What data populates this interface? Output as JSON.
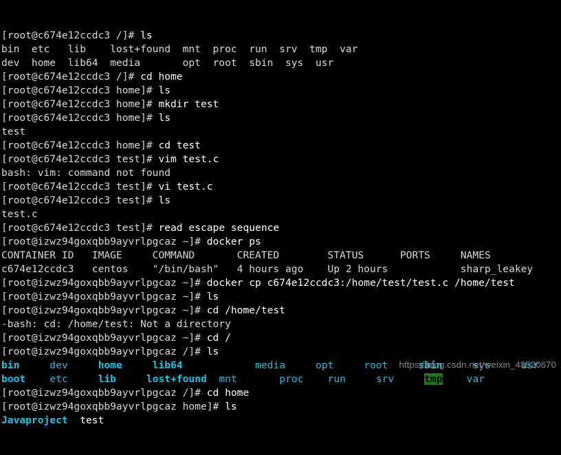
{
  "terminal": {
    "background_color": "#000000",
    "foreground_color": "#d8d8d8",
    "dir_color": "#29b8db",
    "dir_bold_color": "#29d8f0",
    "sticky_dir_bg_color": "#1c7a14",
    "sticky_dir_fg_color": "#000000",
    "prompt_container": "[root@c674e12ccdc3 /]# ",
    "prompt_container_home": "[root@c674e12ccdc3 home]# ",
    "prompt_container_test": "[root@c674e12ccdc3 test]# ",
    "prompt_host_tilde": "[root@izwz94goxqbb9ayvrlpgcaz ~]# ",
    "prompt_host_root": "[root@izwz94goxqbb9ayvrlpgcaz /]# ",
    "prompt_host_home": "[root@izwz94goxqbb9ayvrlpgcaz home]# ",
    "lines": [
      {
        "id": "l01",
        "type": "prompt",
        "prompt": "[root@c674e12ccdc3 /]# ",
        "command": "ls"
      },
      {
        "id": "l02",
        "type": "plain",
        "text": "bin  etc   lib    lost+found  mnt  proc  run  srv  tmp  var"
      },
      {
        "id": "l03",
        "type": "plain",
        "text": "dev  home  lib64  media       opt  root  sbin  sys  usr"
      },
      {
        "id": "l04",
        "type": "prompt",
        "prompt": "[root@c674e12ccdc3 /]# ",
        "command": "cd home"
      },
      {
        "id": "l05",
        "type": "prompt",
        "prompt": "[root@c674e12ccdc3 home]# ",
        "command": "ls"
      },
      {
        "id": "l06",
        "type": "prompt",
        "prompt": "[root@c674e12ccdc3 home]# ",
        "command": "mkdir test"
      },
      {
        "id": "l07",
        "type": "prompt",
        "prompt": "[root@c674e12ccdc3 home]# ",
        "command": "ls"
      },
      {
        "id": "l08",
        "type": "plain",
        "text": "test"
      },
      {
        "id": "l09",
        "type": "prompt",
        "prompt": "[root@c674e12ccdc3 home]# ",
        "command": "cd test"
      },
      {
        "id": "l10",
        "type": "prompt",
        "prompt": "[root@c674e12ccdc3 test]# ",
        "command": "vim test.c"
      },
      {
        "id": "l11",
        "type": "plain",
        "text": "bash: vim: command not found"
      },
      {
        "id": "l12",
        "type": "prompt",
        "prompt": "[root@c674e12ccdc3 test]# ",
        "command": "vi test.c"
      },
      {
        "id": "l13",
        "type": "prompt",
        "prompt": "[root@c674e12ccdc3 test]# ",
        "command": "ls"
      },
      {
        "id": "l14",
        "type": "plain",
        "text": "test.c"
      },
      {
        "id": "l15",
        "type": "prompt",
        "prompt": "[root@c674e12ccdc3 test]# ",
        "command": "read escape sequence"
      },
      {
        "id": "l16",
        "type": "prompt",
        "prompt": "[root@izwz94goxqbb9ayvrlpgcaz ~]# ",
        "command": "docker ps"
      },
      {
        "id": "l17",
        "type": "plain",
        "text": "CONTAINER ID   IMAGE     COMMAND       CREATED        STATUS      PORTS     NAMES"
      },
      {
        "id": "l18",
        "type": "plain",
        "text": "c674e12ccdc3   centos    \"/bin/bash\"   4 hours ago    Up 2 hours            sharp_leakey"
      },
      {
        "id": "l19",
        "type": "prompt",
        "prompt": "[root@izwz94goxqbb9ayvrlpgcaz ~]# ",
        "command": "docker cp c674e12ccdc3:/home/test/test.c /home/test"
      },
      {
        "id": "l20",
        "type": "prompt",
        "prompt": "[root@izwz94goxqbb9ayvrlpgcaz ~]# ",
        "command": "ls"
      },
      {
        "id": "l21",
        "type": "prompt",
        "prompt": "[root@izwz94goxqbb9ayvrlpgcaz ~]# ",
        "command": "cd /home/test"
      },
      {
        "id": "l22",
        "type": "plain",
        "text": "-bash: cd: /home/test: Not a directory"
      },
      {
        "id": "l23",
        "type": "prompt",
        "prompt": "[root@izwz94goxqbb9ayvrlpgcaz ~]# ",
        "command": "cd /"
      },
      {
        "id": "l24",
        "type": "prompt",
        "prompt": "[root@izwz94goxqbb9ayvrlpgcaz /]# ",
        "command": "ls"
      },
      {
        "id": "l25",
        "type": "colorls",
        "cells": [
          {
            "text": "bin",
            "style": "dir-bold",
            "pad": 5
          },
          {
            "text": "dev",
            "style": "dir",
            "pad": 5
          },
          {
            "text": "home",
            "style": "dir-bold",
            "pad": 5
          },
          {
            "text": "lib64",
            "style": "dir-bold",
            "pad": 12
          },
          {
            "text": "media",
            "style": "dir",
            "pad": 5
          },
          {
            "text": "opt",
            "style": "dir",
            "pad": 5
          },
          {
            "text": "root",
            "style": "dir",
            "pad": 5
          },
          {
            "text": "sbin",
            "style": "dir-bold",
            "pad": 5
          },
          {
            "text": "sys",
            "style": "dir",
            "pad": 5
          },
          {
            "text": "usr",
            "style": "dir",
            "pad": 0
          }
        ]
      },
      {
        "id": "l26",
        "type": "colorls",
        "cells": [
          {
            "text": "boot",
            "style": "dir-bold",
            "pad": 4
          },
          {
            "text": "etc",
            "style": "dir",
            "pad": 5
          },
          {
            "text": "lib",
            "style": "dir-bold",
            "pad": 5
          },
          {
            "text": "lost+found",
            "style": "dir-bold",
            "pad": 2
          },
          {
            "text": "mnt",
            "style": "dir",
            "pad": 7
          },
          {
            "text": "proc",
            "style": "dir",
            "pad": 4
          },
          {
            "text": "run",
            "style": "dir",
            "pad": 5
          },
          {
            "text": "srv",
            "style": "dir",
            "pad": 5
          },
          {
            "text": "tmp",
            "style": "sticky",
            "pad": 4
          },
          {
            "text": "var",
            "style": "dir",
            "pad": 0
          }
        ]
      },
      {
        "id": "l27",
        "type": "prompt",
        "prompt": "[root@izwz94goxqbb9ayvrlpgcaz /]# ",
        "command": "cd home"
      },
      {
        "id": "l28",
        "type": "prompt",
        "prompt": "[root@izwz94goxqbb9ayvrlpgcaz home]# ",
        "command": "ls"
      },
      {
        "id": "l29",
        "type": "colorls",
        "cells": [
          {
            "text": "Javaproject",
            "style": "dir-bold",
            "pad": 2
          },
          {
            "text": "test",
            "style": "file",
            "pad": 0
          }
        ]
      }
    ]
  },
  "docker_ps": {
    "headers": [
      "CONTAINER ID",
      "IMAGE",
      "COMMAND",
      "CREATED",
      "STATUS",
      "PORTS",
      "NAMES"
    ],
    "rows": [
      {
        "container_id": "c674e12ccdc3",
        "image": "centos",
        "command": "\"/bin/bash\"",
        "created": "4 hours ago",
        "status": "Up 2 hours",
        "ports": "",
        "names": "sharp_leakey"
      }
    ]
  },
  "watermark": {
    "text": "https://blog.csdn.net/weixin_43520670"
  }
}
